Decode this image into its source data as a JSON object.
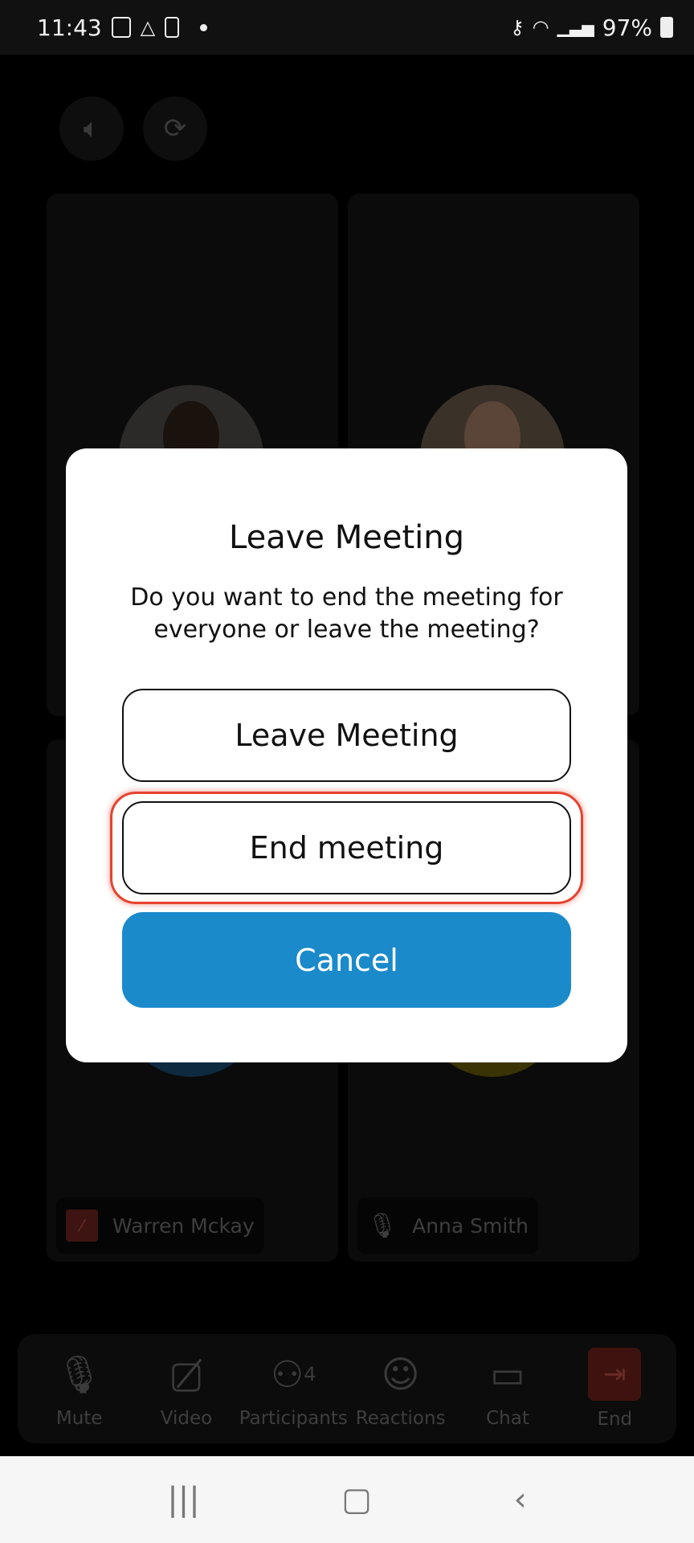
{
  "status_bar": {
    "time": "11:43",
    "battery": "97%",
    "icons": [
      "image-icon",
      "drive-icon",
      "phone-check-icon",
      "dot-icon",
      "key-icon",
      "wifi-icon",
      "signal-icon",
      "battery-icon"
    ]
  },
  "top_controls": [
    {
      "icon": "speaker-icon"
    },
    {
      "icon": "switch-camera-icon"
    }
  ],
  "participants": [
    {
      "name": "Warren Mckay",
      "mic": "muted"
    },
    {
      "name": "Anna Smith",
      "mic": "on"
    }
  ],
  "toolbar": {
    "items": [
      {
        "label": "Mute",
        "icon": "microphone-icon"
      },
      {
        "label": "Video",
        "icon": "video-off-icon"
      },
      {
        "label": "Participants",
        "icon": "participants-icon",
        "count": "4"
      },
      {
        "label": "Reactions",
        "icon": "emoji-plus-icon"
      },
      {
        "label": "Chat",
        "icon": "chat-icon"
      },
      {
        "label": "End",
        "icon": "exit-icon"
      }
    ],
    "end_color": "#3e130f"
  },
  "dialog": {
    "title": "Leave Meeting",
    "message": "Do you want to end the meeting for everyone or leave the meeting?",
    "leave_label": "Leave Meeting",
    "end_label": "End meeting",
    "cancel_label": "Cancel",
    "cancel_color": "#1a8acb",
    "highlight_color": "#e5432f"
  },
  "nav_bar": {
    "items": [
      "recents-icon",
      "home-icon",
      "back-icon"
    ]
  }
}
